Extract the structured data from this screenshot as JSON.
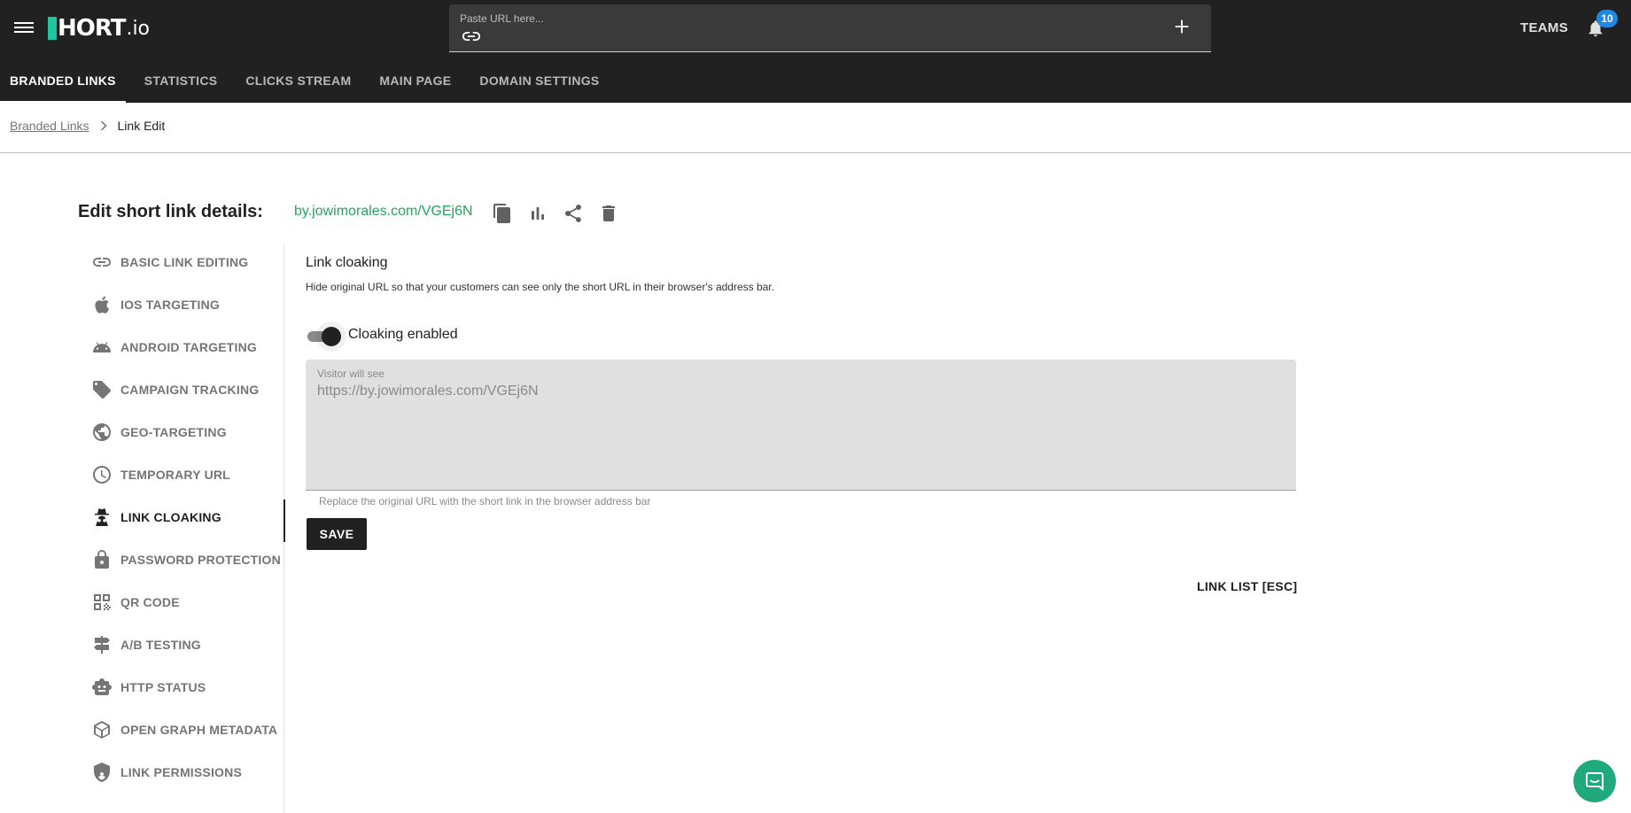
{
  "header": {
    "logo_text": "HORT",
    "logo_suffix": ".io",
    "url_placeholder": "Paste URL here...",
    "teams_label": "TEAMS",
    "notification_count": "10"
  },
  "tabs": [
    {
      "label": "BRANDED LINKS",
      "active": true
    },
    {
      "label": "STATISTICS"
    },
    {
      "label": "CLICKS STREAM"
    },
    {
      "label": "MAIN PAGE"
    },
    {
      "label": "DOMAIN SETTINGS"
    }
  ],
  "breadcrumb": {
    "parent": "Branded Links",
    "current": "Link Edit"
  },
  "edit": {
    "title": "Edit short link details:",
    "short_link": "by.jowimorales.com/VGEj6N",
    "actions": [
      "copy-icon",
      "statistics-icon",
      "share-icon",
      "delete-icon"
    ]
  },
  "sidebar": {
    "items": [
      {
        "label": "BASIC LINK EDITING",
        "icon": "link-icon"
      },
      {
        "label": "IOS TARGETING",
        "icon": "apple-icon"
      },
      {
        "label": "ANDROID TARGETING",
        "icon": "android-icon"
      },
      {
        "label": "CAMPAIGN TRACKING",
        "icon": "tag-icon"
      },
      {
        "label": "GEO-TARGETING",
        "icon": "globe-icon"
      },
      {
        "label": "TEMPORARY URL",
        "icon": "clock-icon"
      },
      {
        "label": "LINK CLOAKING",
        "icon": "incognito-icon",
        "active": true
      },
      {
        "label": "PASSWORD PROTECTION",
        "icon": "lock-icon"
      },
      {
        "label": "QR CODE",
        "icon": "qr-code-icon"
      },
      {
        "label": "A/B TESTING",
        "icon": "signpost-icon"
      },
      {
        "label": "HTTP STATUS",
        "icon": "robot-icon"
      },
      {
        "label": "OPEN GRAPH METADATA",
        "icon": "web-icon"
      },
      {
        "label": "LINK PERMISSIONS",
        "icon": "shield-icon"
      }
    ]
  },
  "cloaking": {
    "title": "Link cloaking",
    "description": "Hide original URL so that your customers can see only the short URL in their browser's address bar.",
    "toggle_label": "Cloaking enabled",
    "toggle_on": true,
    "field_label": "Visitor will see",
    "field_value": "https://by.jowimorales.com/VGEj6N",
    "helper_text": "Replace the original URL with the short link in the browser address bar",
    "save_label": "SAVE",
    "link_list_label": "LINK LIST [ESC]"
  },
  "colors": {
    "header_bg": "#212121",
    "brand_green": "#1fc6a1",
    "link_green": "#26a65b",
    "badge_blue": "#1e88e5",
    "chat_green": "#1fa97d"
  }
}
